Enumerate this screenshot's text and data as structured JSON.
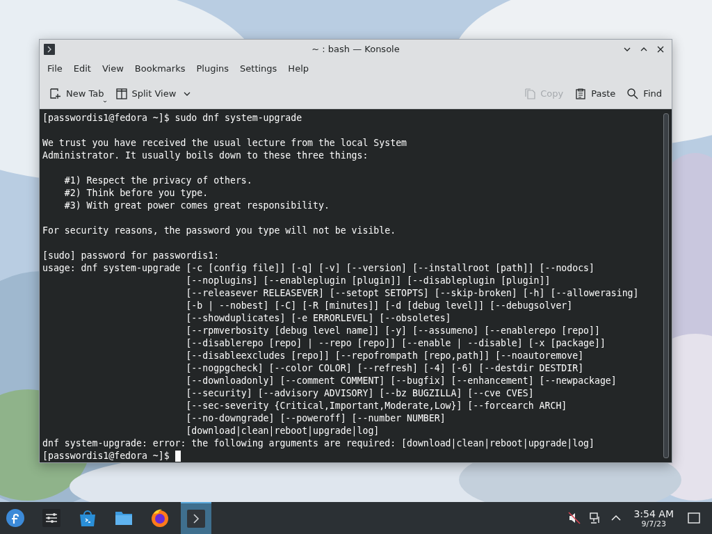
{
  "window": {
    "title": "~ : bash — Konsole"
  },
  "menu": [
    "File",
    "Edit",
    "View",
    "Bookmarks",
    "Plugins",
    "Settings",
    "Help"
  ],
  "toolbar": {
    "left": [
      {
        "label": "New Tab",
        "kind": "newtab",
        "disabled": false
      },
      {
        "label": "Split View",
        "kind": "split",
        "disabled": false
      }
    ],
    "right": [
      {
        "label": "Copy",
        "kind": "copy",
        "disabled": true
      },
      {
        "label": "Paste",
        "kind": "paste",
        "disabled": false
      },
      {
        "label": "Find",
        "kind": "find",
        "disabled": false
      }
    ]
  },
  "terminal": {
    "blocks": [
      [
        "[passwordis1@fedora ~]$ sudo dnf system-upgrade"
      ],
      [
        "We trust you have received the usual lecture from the local System",
        "Administrator. It usually boils down to these three things:"
      ],
      [
        "    #1) Respect the privacy of others.",
        "    #2) Think before you type.",
        "    #3) With great power comes great responsibility."
      ],
      [
        "For security reasons, the password you type will not be visible."
      ],
      [
        "[sudo] password for passwordis1:",
        "usage: dnf system-upgrade [-c [config file]] [-q] [-v] [--version] [--installroot [path]] [--nodocs]",
        "                          [--noplugins] [--enableplugin [plugin]] [--disableplugin [plugin]]",
        "                          [--releasever RELEASEVER] [--setopt SETOPTS] [--skip-broken] [-h] [--allowerasing]",
        "                          [-b | --nobest] [-C] [-R [minutes]] [-d [debug level]] [--debugsolver]",
        "                          [--showduplicates] [-e ERRORLEVEL] [--obsoletes]",
        "                          [--rpmverbosity [debug level name]] [-y] [--assumeno] [--enablerepo [repo]]",
        "                          [--disablerepo [repo] | --repo [repo]] [--enable | --disable] [-x [package]]",
        "                          [--disableexcludes [repo]] [--repofrompath [repo,path]] [--noautoremove]",
        "                          [--nogpgcheck] [--color COLOR] [--refresh] [-4] [-6] [--destdir DESTDIR]",
        "                          [--downloadonly] [--comment COMMENT] [--bugfix] [--enhancement] [--newpackage]",
        "                          [--security] [--advisory ADVISORY] [--bz BUGZILLA] [--cve CVES]",
        "                          [--sec-severity {Critical,Important,Moderate,Low}] [--forcearch ARCH]",
        "                          [--no-downgrade] [--poweroff] [--number NUMBER]",
        "                          [download|clean|reboot|upgrade|log]",
        "dnf system-upgrade: error: the following arguments are required: [download|clean|reboot|upgrade|log]",
        "[passwordis1@fedora ~]$ "
      ]
    ],
    "cursor": true
  },
  "taskbar": {
    "apps": [
      {
        "kind": "launcher",
        "selected": false
      },
      {
        "kind": "settings",
        "selected": false
      },
      {
        "kind": "store",
        "selected": false
      },
      {
        "kind": "files",
        "selected": false
      },
      {
        "kind": "browser",
        "selected": false
      },
      {
        "kind": "terminal",
        "selected": true
      }
    ],
    "clock": {
      "time": "3:54 AM",
      "date": "9/7/23"
    }
  }
}
